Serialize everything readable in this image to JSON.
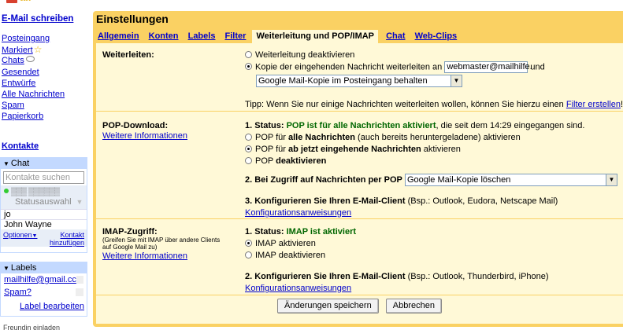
{
  "nav": {
    "compose": "E-Mail schreiben",
    "folders": {
      "inbox": "Posteingang",
      "starred": "Markiert",
      "chats": "Chats",
      "sent": "Gesendet",
      "drafts": "Entwürfe",
      "all": "Alle Nachrichten",
      "spam": "Spam",
      "trash": "Papierkorb"
    },
    "contacts": "Kontakte",
    "chat": {
      "header": "Chat",
      "search_placeholder": "Kontakte suchen",
      "status": "Statusauswahl",
      "contacts": [
        "jo",
        "John Wayne"
      ],
      "options": "Optionen",
      "add_contact_1": "Kontakt",
      "add_contact_2": "hinzufügen"
    },
    "labels": {
      "header": "Labels",
      "items": [
        "mailhilfe@gmail.cc",
        "Spam?"
      ],
      "edit": "Label bearbeiten"
    },
    "footer_cut": "Freundin einladen"
  },
  "settings": {
    "title": "Einstellungen",
    "tabs": [
      "Allgemein",
      "Konten",
      "Labels",
      "Filter",
      "Weiterleitung und POP/IMAP",
      "Chat",
      "Web-Clips"
    ],
    "forward": {
      "label": "Weiterleiten:",
      "opt_off": "Weiterleitung deaktivieren",
      "opt_on_prefix": "Kopie der eingehenden Nachricht weiterleiten an",
      "address": "webmaster@mailhilfe.",
      "opt_on_suffix": "und",
      "action": "Google Mail-Kopie im Posteingang behalten",
      "tip": "Tipp: Wenn Sie nur einige Nachrichten weiterleiten wollen, können Sie hierzu einen",
      "tip_link": "Filter erstellen",
      "tip_end": "!"
    },
    "pop": {
      "label": "POP-Download:",
      "more": "Weitere Informationen",
      "status_prefix": "1. Status:",
      "status_value": "POP ist für alle Nachrichten aktiviert",
      "status_suffix": ", die seit dem 14:29 eingegangen sind.",
      "opt1_a": "POP für",
      "opt1_b": "alle Nachrichten",
      "opt1_c": "(auch bereits heruntergeladene) aktivieren",
      "opt2_a": "POP für",
      "opt2_b": "ab jetzt eingehende Nachrichten",
      "opt2_c": "aktivieren",
      "opt3_a": "POP",
      "opt3_b": "deaktivieren",
      "access_label": "2. Bei Zugriff auf Nachrichten per POP",
      "access_value": "Google Mail-Kopie löschen",
      "client_label": "3. Konfigurieren Sie Ihren E-Mail-Client",
      "client_examples": "(Bsp.: Outlook, Eudora, Netscape Mail)",
      "config_link": "Konfigurationsanweisungen"
    },
    "imap": {
      "label": "IMAP-Zugriff:",
      "sub": "(Greifen Sie mit IMAP über andere Clients auf Google Mail zu)",
      "more": "Weitere Informationen",
      "status_prefix": "1. Status:",
      "status_value": "IMAP ist aktiviert",
      "opt_on": "IMAP aktivieren",
      "opt_off": "IMAP deaktivieren",
      "client_label": "2. Konfigurieren Sie Ihren E-Mail-Client",
      "client_examples": "(Bsp.: Outlook, Thunderbird, iPhone)",
      "config_link": "Konfigurationsanweisungen"
    },
    "save": "Änderungen speichern",
    "cancel": "Abbrechen"
  }
}
